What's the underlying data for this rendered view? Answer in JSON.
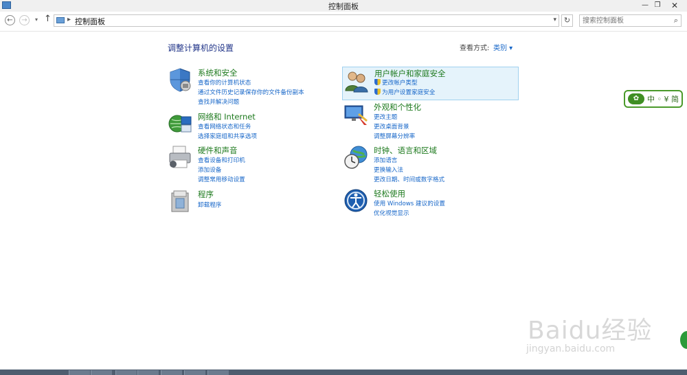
{
  "window": {
    "title": "控制面板",
    "min_glyph": "—",
    "max_glyph": "❐",
    "close_glyph": "✕"
  },
  "nav": {
    "back_glyph": "←",
    "forward_glyph": "→",
    "recent_glyph": "▾",
    "up_glyph": "↑",
    "breadcrumb_sep": "▸",
    "breadcrumb": "控制面板",
    "address_dropdown_glyph": "▾",
    "refresh_glyph": "↻",
    "search_placeholder": "搜索控制面板",
    "search_glyph": "⌕"
  },
  "header": {
    "title": "调整计算机的设置",
    "view_label": "查看方式:",
    "view_value": "类别 ▾"
  },
  "categories": [
    {
      "heading": "系统和安全",
      "icon": "shield-security-icon",
      "links": [
        "查看你的计算机状态",
        "通过文件历史记录保存你的文件备份副本",
        "查找并解决问题"
      ]
    },
    {
      "heading": "网络和 Internet",
      "icon": "network-globe-icon",
      "links": [
        "查看网络状态和任务",
        "选择家庭组和共享选项"
      ]
    },
    {
      "heading": "硬件和声音",
      "icon": "printer-hardware-icon",
      "links": [
        "查看设备和打印机",
        "添加设备",
        "调整常用移动设置"
      ]
    },
    {
      "heading": "程序",
      "icon": "programs-box-icon",
      "links": [
        "卸载程序"
      ]
    },
    {
      "heading": "用户帐户和家庭安全",
      "icon": "users-icon",
      "links": [
        "更改帐户类型",
        "为用户设置家庭安全"
      ],
      "highlighted": true
    },
    {
      "heading": "外观和个性化",
      "icon": "monitor-appearance-icon",
      "links": [
        "更改主题",
        "更改桌面背景",
        "调整屏幕分辨率"
      ]
    },
    {
      "heading": "时钟、语言和区域",
      "icon": "clock-globe-icon",
      "links": [
        "添加语言",
        "更换输入法",
        "更改日期、时间或数字格式"
      ]
    },
    {
      "heading": "轻松使用",
      "icon": "ease-of-access-icon",
      "links": [
        "使用 Windows 建议的设置",
        "优化视觉显示"
      ]
    }
  ],
  "ime_widget": {
    "text": "中 ◦ ¥ 简"
  },
  "watermark": {
    "brand": "Baidu经验",
    "url": "jingyan.baidu.com"
  },
  "colors": {
    "heading_green": "#1e7a1e",
    "link_blue": "#1666c8",
    "title_blue": "#1e3287",
    "highlight_bg": "#e5f3fb"
  }
}
